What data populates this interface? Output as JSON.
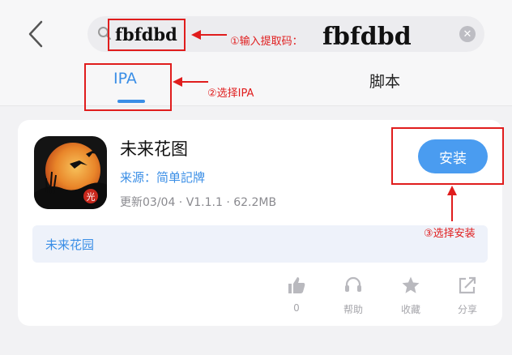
{
  "search": {
    "value": "fbfdbd",
    "back_icon": "chevron-left-icon",
    "search_icon": "search-icon",
    "clear_icon": "close-circle-icon"
  },
  "tabs": [
    {
      "label": "IPA",
      "active": true
    },
    {
      "label": "脚本",
      "active": false
    }
  ],
  "annotations": {
    "step1": "①输入提取码：",
    "step1_code": "fbfdbd",
    "step2": "②选择IPA",
    "step3": "③选择安装"
  },
  "app": {
    "name": "未来花图",
    "source": "来源：简单記牌",
    "meta": "更新03/04 · V1.1.1 · 62.2MB",
    "install_label": "安装",
    "icon_badge": "光",
    "description": "未来花园"
  },
  "actions": [
    {
      "icon": "thumbs-up-icon",
      "label": "0"
    },
    {
      "icon": "headset-icon",
      "label": "帮助"
    },
    {
      "icon": "star-icon",
      "label": "收藏"
    },
    {
      "icon": "share-icon",
      "label": "分享"
    }
  ],
  "colors": {
    "accent": "#3a8ee6",
    "annotation": "#e01d1d",
    "install_button": "#4a9cf0"
  }
}
